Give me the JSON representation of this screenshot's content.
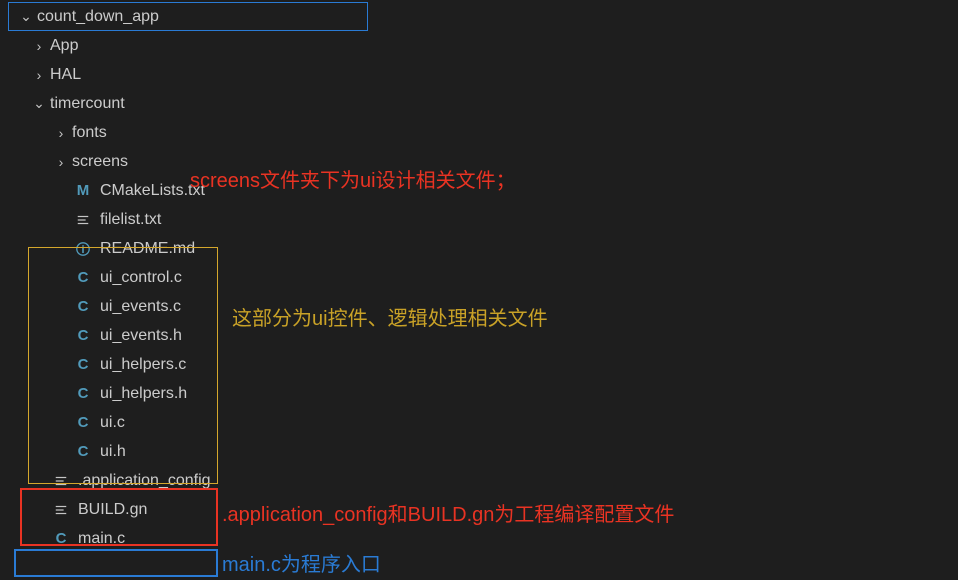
{
  "tree": {
    "root": {
      "label": "count_down_app",
      "expanded": true
    },
    "children": [
      {
        "label": "App",
        "kind": "folder",
        "expanded": false,
        "indent": 1
      },
      {
        "label": "HAL",
        "kind": "folder",
        "expanded": false,
        "indent": 1
      },
      {
        "label": "timercount",
        "kind": "folder",
        "expanded": true,
        "indent": 1
      },
      {
        "label": "fonts",
        "kind": "folder",
        "expanded": false,
        "indent": 2
      },
      {
        "label": "screens",
        "kind": "folder",
        "expanded": false,
        "indent": 2
      },
      {
        "label": "CMakeLists.txt",
        "kind": "file",
        "icon": "M",
        "indent": 2
      },
      {
        "label": "filelist.txt",
        "kind": "file",
        "icon": "lines",
        "indent": 2
      },
      {
        "label": "README.md",
        "kind": "file",
        "icon": "info",
        "indent": 2
      },
      {
        "label": "ui_control.c",
        "kind": "file",
        "icon": "C",
        "indent": 2
      },
      {
        "label": "ui_events.c",
        "kind": "file",
        "icon": "C",
        "indent": 2
      },
      {
        "label": "ui_events.h",
        "kind": "file",
        "icon": "C",
        "indent": 2
      },
      {
        "label": "ui_helpers.c",
        "kind": "file",
        "icon": "C",
        "indent": 2
      },
      {
        "label": "ui_helpers.h",
        "kind": "file",
        "icon": "C",
        "indent": 2
      },
      {
        "label": "ui.c",
        "kind": "file",
        "icon": "C",
        "indent": 2
      },
      {
        "label": "ui.h",
        "kind": "file",
        "icon": "C",
        "indent": 2
      },
      {
        "label": ".application_config",
        "kind": "file",
        "icon": "lines",
        "indent": 1
      },
      {
        "label": "BUILD.gn",
        "kind": "file",
        "icon": "lines",
        "indent": 1
      },
      {
        "label": "main.c",
        "kind": "file",
        "icon": "C",
        "indent": 1
      }
    ]
  },
  "annotations": {
    "a1": "screens文件夹下为ui设计相关文件；",
    "a2": "这部分为ui控件、逻辑处理相关文件",
    "a3": ".application_config和BUILD.gn为工程编译配置文件",
    "a4": "main.c为程序入口"
  },
  "colors": {
    "bg": "#1e1e1e",
    "text": "#cccccc",
    "cIcon": "#519aba",
    "highlightBlue": "#2a7bd4",
    "highlightRed": "#e93323",
    "highlightYellow": "#d4a72c"
  }
}
